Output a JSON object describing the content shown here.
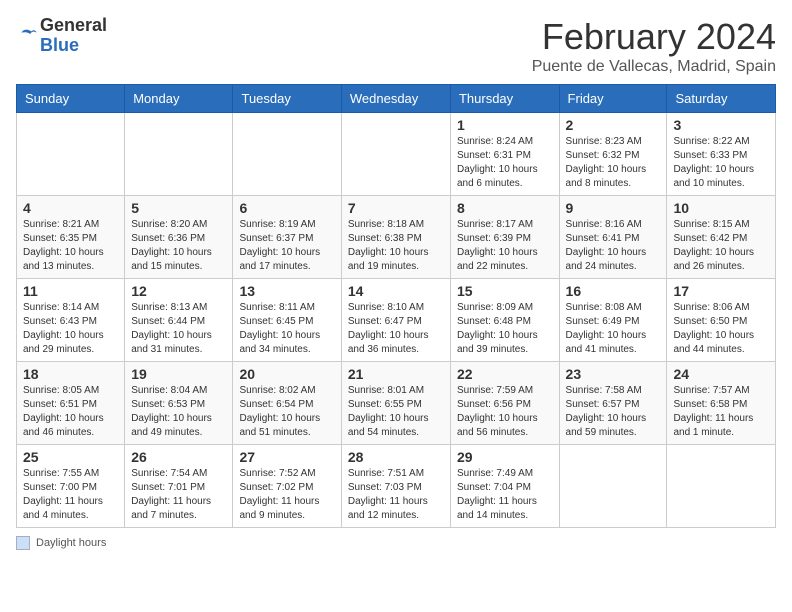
{
  "header": {
    "logo_general": "General",
    "logo_blue": "Blue",
    "title": "February 2024",
    "subtitle": "Puente de Vallecas, Madrid, Spain"
  },
  "days_of_week": [
    "Sunday",
    "Monday",
    "Tuesday",
    "Wednesday",
    "Thursday",
    "Friday",
    "Saturday"
  ],
  "weeks": [
    [
      {
        "day": "",
        "info": ""
      },
      {
        "day": "",
        "info": ""
      },
      {
        "day": "",
        "info": ""
      },
      {
        "day": "",
        "info": ""
      },
      {
        "day": "1",
        "info": "Sunrise: 8:24 AM\nSunset: 6:31 PM\nDaylight: 10 hours and 6 minutes."
      },
      {
        "day": "2",
        "info": "Sunrise: 8:23 AM\nSunset: 6:32 PM\nDaylight: 10 hours and 8 minutes."
      },
      {
        "day": "3",
        "info": "Sunrise: 8:22 AM\nSunset: 6:33 PM\nDaylight: 10 hours and 10 minutes."
      }
    ],
    [
      {
        "day": "4",
        "info": "Sunrise: 8:21 AM\nSunset: 6:35 PM\nDaylight: 10 hours and 13 minutes."
      },
      {
        "day": "5",
        "info": "Sunrise: 8:20 AM\nSunset: 6:36 PM\nDaylight: 10 hours and 15 minutes."
      },
      {
        "day": "6",
        "info": "Sunrise: 8:19 AM\nSunset: 6:37 PM\nDaylight: 10 hours and 17 minutes."
      },
      {
        "day": "7",
        "info": "Sunrise: 8:18 AM\nSunset: 6:38 PM\nDaylight: 10 hours and 19 minutes."
      },
      {
        "day": "8",
        "info": "Sunrise: 8:17 AM\nSunset: 6:39 PM\nDaylight: 10 hours and 22 minutes."
      },
      {
        "day": "9",
        "info": "Sunrise: 8:16 AM\nSunset: 6:41 PM\nDaylight: 10 hours and 24 minutes."
      },
      {
        "day": "10",
        "info": "Sunrise: 8:15 AM\nSunset: 6:42 PM\nDaylight: 10 hours and 26 minutes."
      }
    ],
    [
      {
        "day": "11",
        "info": "Sunrise: 8:14 AM\nSunset: 6:43 PM\nDaylight: 10 hours and 29 minutes."
      },
      {
        "day": "12",
        "info": "Sunrise: 8:13 AM\nSunset: 6:44 PM\nDaylight: 10 hours and 31 minutes."
      },
      {
        "day": "13",
        "info": "Sunrise: 8:11 AM\nSunset: 6:45 PM\nDaylight: 10 hours and 34 minutes."
      },
      {
        "day": "14",
        "info": "Sunrise: 8:10 AM\nSunset: 6:47 PM\nDaylight: 10 hours and 36 minutes."
      },
      {
        "day": "15",
        "info": "Sunrise: 8:09 AM\nSunset: 6:48 PM\nDaylight: 10 hours and 39 minutes."
      },
      {
        "day": "16",
        "info": "Sunrise: 8:08 AM\nSunset: 6:49 PM\nDaylight: 10 hours and 41 minutes."
      },
      {
        "day": "17",
        "info": "Sunrise: 8:06 AM\nSunset: 6:50 PM\nDaylight: 10 hours and 44 minutes."
      }
    ],
    [
      {
        "day": "18",
        "info": "Sunrise: 8:05 AM\nSunset: 6:51 PM\nDaylight: 10 hours and 46 minutes."
      },
      {
        "day": "19",
        "info": "Sunrise: 8:04 AM\nSunset: 6:53 PM\nDaylight: 10 hours and 49 minutes."
      },
      {
        "day": "20",
        "info": "Sunrise: 8:02 AM\nSunset: 6:54 PM\nDaylight: 10 hours and 51 minutes."
      },
      {
        "day": "21",
        "info": "Sunrise: 8:01 AM\nSunset: 6:55 PM\nDaylight: 10 hours and 54 minutes."
      },
      {
        "day": "22",
        "info": "Sunrise: 7:59 AM\nSunset: 6:56 PM\nDaylight: 10 hours and 56 minutes."
      },
      {
        "day": "23",
        "info": "Sunrise: 7:58 AM\nSunset: 6:57 PM\nDaylight: 10 hours and 59 minutes."
      },
      {
        "day": "24",
        "info": "Sunrise: 7:57 AM\nSunset: 6:58 PM\nDaylight: 11 hours and 1 minute."
      }
    ],
    [
      {
        "day": "25",
        "info": "Sunrise: 7:55 AM\nSunset: 7:00 PM\nDaylight: 11 hours and 4 minutes."
      },
      {
        "day": "26",
        "info": "Sunrise: 7:54 AM\nSunset: 7:01 PM\nDaylight: 11 hours and 7 minutes."
      },
      {
        "day": "27",
        "info": "Sunrise: 7:52 AM\nSunset: 7:02 PM\nDaylight: 11 hours and 9 minutes."
      },
      {
        "day": "28",
        "info": "Sunrise: 7:51 AM\nSunset: 7:03 PM\nDaylight: 11 hours and 12 minutes."
      },
      {
        "day": "29",
        "info": "Sunrise: 7:49 AM\nSunset: 7:04 PM\nDaylight: 11 hours and 14 minutes."
      },
      {
        "day": "",
        "info": ""
      },
      {
        "day": "",
        "info": ""
      }
    ]
  ],
  "footer": {
    "legend_label": "Daylight hours"
  }
}
